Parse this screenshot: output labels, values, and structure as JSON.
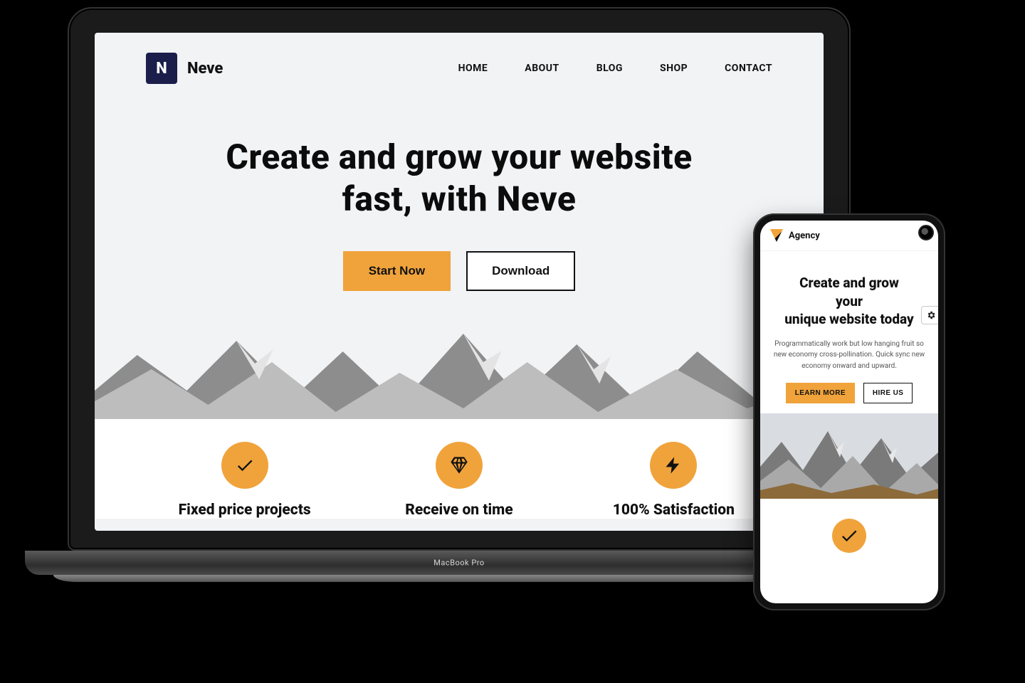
{
  "device": {
    "laptop_label": "MacBook Pro"
  },
  "desktop": {
    "brand": {
      "name": "Neve",
      "logo_letter": "N"
    },
    "nav": [
      "HOME",
      "ABOUT",
      "BLOG",
      "SHOP",
      "CONTACT"
    ],
    "hero_line1": "Create and grow your website",
    "hero_line2": "fast, with Neve",
    "cta_primary": "Start Now",
    "cta_secondary": "Download",
    "features": [
      {
        "icon": "check",
        "title": "Fixed price projects"
      },
      {
        "icon": "diamond",
        "title": "Receive on time"
      },
      {
        "icon": "bolt",
        "title": "100% Satisfaction"
      }
    ]
  },
  "mobile": {
    "brand": "Agency",
    "hero_line1": "Create and grow",
    "hero_line2": "your",
    "hero_line3": "unique website today",
    "subtext": "Programmatically work but low hanging fruit so new economy cross-pollination. Quick sync new economy onward and upward.",
    "cta_primary": "LEARN MORE",
    "cta_secondary": "HIRE US"
  },
  "colors": {
    "accent": "#f0a33b",
    "brandblue": "#1b1e4b"
  }
}
